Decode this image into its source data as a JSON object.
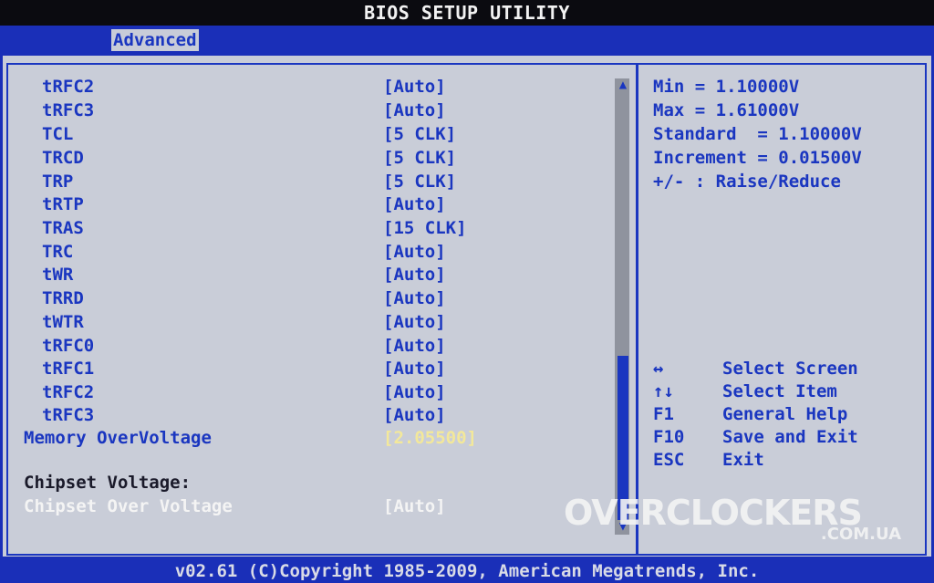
{
  "app": {
    "title": "BIOS SETUP UTILITY"
  },
  "tabs": [
    {
      "label": "Advanced",
      "active": true
    }
  ],
  "settings": [
    {
      "label": "tRFC2",
      "value": "[Auto]"
    },
    {
      "label": "tRFC3",
      "value": "[Auto]"
    },
    {
      "label": "TCL",
      "value": "[5 CLK]"
    },
    {
      "label": "TRCD",
      "value": "[5 CLK]"
    },
    {
      "label": "TRP",
      "value": "[5 CLK]"
    },
    {
      "label": "tRTP",
      "value": "[Auto]"
    },
    {
      "label": "TRAS",
      "value": "[15 CLK]"
    },
    {
      "label": "TRC",
      "value": "[Auto]"
    },
    {
      "label": "tWR",
      "value": "[Auto]"
    },
    {
      "label": "TRRD",
      "value": "[Auto]"
    },
    {
      "label": "tWTR",
      "value": "[Auto]"
    },
    {
      "label": "tRFC0",
      "value": "[Auto]"
    },
    {
      "label": "tRFC1",
      "value": "[Auto]"
    },
    {
      "label": "tRFC2",
      "value": "[Auto]"
    },
    {
      "label": "tRFC3",
      "value": "[Auto]"
    }
  ],
  "memory_overvoltage": {
    "label": "Memory OverVoltage",
    "value": "[2.05500]"
  },
  "chipset_section": {
    "heading": "Chipset Voltage:"
  },
  "chipset_overvoltage": {
    "label": "Chipset Over Voltage",
    "value": "[Auto]"
  },
  "help": {
    "lines": [
      "Min = 1.10000V",
      "Max = 1.61000V",
      "Standard  = 1.10000V",
      "Increment = 0.01500V",
      "+/- : Raise/Reduce"
    ]
  },
  "keys": [
    {
      "key": "↔",
      "desc": "Select Screen",
      "icon": "left-right-arrow-icon"
    },
    {
      "key": "↑↓",
      "desc": "Select Item",
      "icon": "up-down-arrow-icon"
    },
    {
      "key": "F1",
      "desc": "General Help"
    },
    {
      "key": "F10",
      "desc": "Save and Exit"
    },
    {
      "key": "ESC",
      "desc": "Exit"
    }
  ],
  "footer": {
    "text": "v02.61 (C)Copyright 1985-2009, American Megatrends, Inc."
  },
  "watermark": {
    "line1": "OVERCLOCKERS",
    "line2": ".COM.UA"
  },
  "colors": {
    "accent": "#1a36c0",
    "panel": "#c9cdd8",
    "highlight": "#f4f4f4",
    "selected_value": "#f3e89a"
  }
}
